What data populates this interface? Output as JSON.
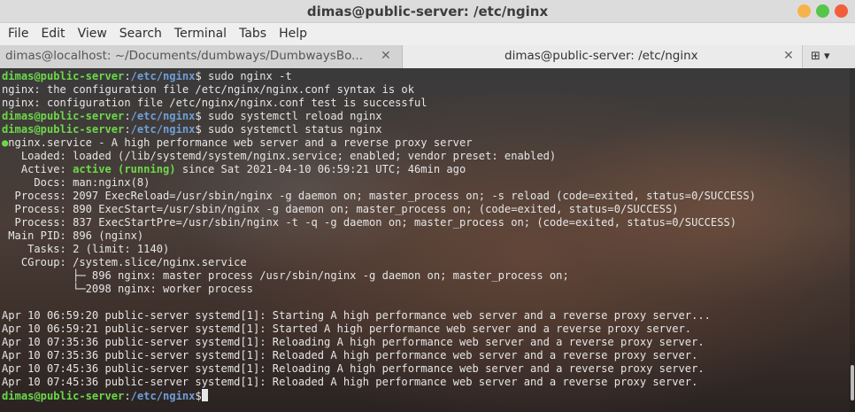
{
  "window": {
    "title": "dimas@public-server: /etc/nginx",
    "controls": [
      {
        "name": "minimize",
        "color": "#f6b34a"
      },
      {
        "name": "maximize",
        "color": "#57c44b"
      },
      {
        "name": "close",
        "color": "#f25e3c"
      }
    ]
  },
  "menubar": [
    "File",
    "Edit",
    "View",
    "Search",
    "Terminal",
    "Tabs",
    "Help"
  ],
  "tabs": [
    {
      "label": "dimas@localhost: ~/Documents/dumbways/DumbwaysBo...",
      "close": "✕",
      "active": false
    },
    {
      "label": "dimas@public-server: /etc/nginx",
      "close": "✕",
      "active": true
    }
  ],
  "new_tab": {
    "icon": "new-tab-icon",
    "glyph": "⊞",
    "arrow": "▾"
  },
  "terminal": {
    "prompt_user": "dimas@public-server",
    "prompt_sep": ":",
    "prompt_path": "/etc/nginx",
    "prompt_dollar": "$",
    "commands": [
      "sudo nginx -t",
      "sudo systemctl reload nginx",
      "sudo systemctl status nginx"
    ],
    "nginx_test": [
      "nginx: the configuration file /etc/nginx/nginx.conf syntax is ok",
      "nginx: configuration file /etc/nginx/nginx.conf test is successful"
    ],
    "status": {
      "bullet": "●",
      "service_line": "nginx.service - A high performance web server and a reverse proxy server",
      "loaded": "   Loaded: loaded (/lib/systemd/system/nginx.service; enabled; vendor preset: enabled)",
      "active_prefix": "   Active: ",
      "active_state": "active (running)",
      "active_suffix": " since Sat 2021-04-10 06:59:21 UTC; 46min ago",
      "docs": "     Docs: man:nginx(8)",
      "process1": "  Process: 2097 ExecReload=/usr/sbin/nginx -g daemon on; master_process on; -s reload (code=exited, status=0/SUCCESS)",
      "process2": "  Process: 890 ExecStart=/usr/sbin/nginx -g daemon on; master_process on; (code=exited, status=0/SUCCESS)",
      "process3": "  Process: 837 ExecStartPre=/usr/sbin/nginx -t -q -g daemon on; master_process on; (code=exited, status=0/SUCCESS)",
      "mainpid": " Main PID: 896 (nginx)",
      "tasks": "    Tasks: 2 (limit: 1140)",
      "cgroup": "   CGroup: /system.slice/nginx.service",
      "tree1": "           ├─ 896 nginx: master process /usr/sbin/nginx -g daemon on; master_process on;",
      "tree2": "           └─2098 nginx: worker process"
    },
    "logs": [
      "Apr 10 06:59:20 public-server systemd[1]: Starting A high performance web server and a reverse proxy server...",
      "Apr 10 06:59:21 public-server systemd[1]: Started A high performance web server and a reverse proxy server.",
      "Apr 10 07:35:36 public-server systemd[1]: Reloading A high performance web server and a reverse proxy server.",
      "Apr 10 07:35:36 public-server systemd[1]: Reloaded A high performance web server and a reverse proxy server.",
      "Apr 10 07:45:36 public-server systemd[1]: Reloading A high performance web server and a reverse proxy server.",
      "Apr 10 07:45:36 public-server systemd[1]: Reloaded A high performance web server and a reverse proxy server."
    ]
  }
}
